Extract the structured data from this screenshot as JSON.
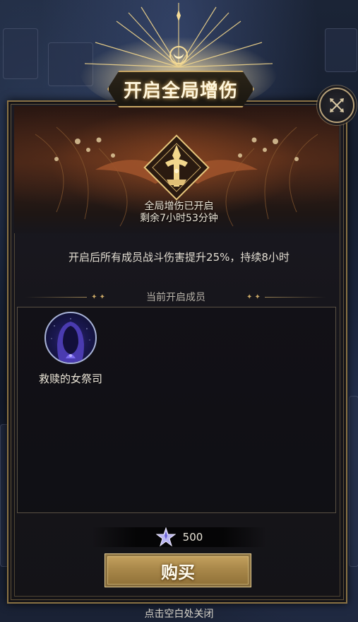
{
  "dialog": {
    "title": "开启全局增伤",
    "status_line1": "全局增伤已开启",
    "status_line2": "剩余7小时53分钟",
    "description": "开启后所有成员战斗伤害提升25%，持续8小时",
    "section_title": "当前开启成员",
    "members": [
      {
        "name": "救赎的女祭司",
        "avatar_icon": "hooded-priestess-avatar"
      }
    ],
    "price": {
      "currency_icon": "crystal-star-icon",
      "value": "500"
    },
    "buy_label": "购买",
    "close_hint": "点击空白处关闭",
    "close_icon": "close-x-icon"
  },
  "colors": {
    "gold": "#c9a765",
    "panel_bg": "#17161c",
    "text": "#ece6d8",
    "buy_button": "#b08f4e"
  }
}
